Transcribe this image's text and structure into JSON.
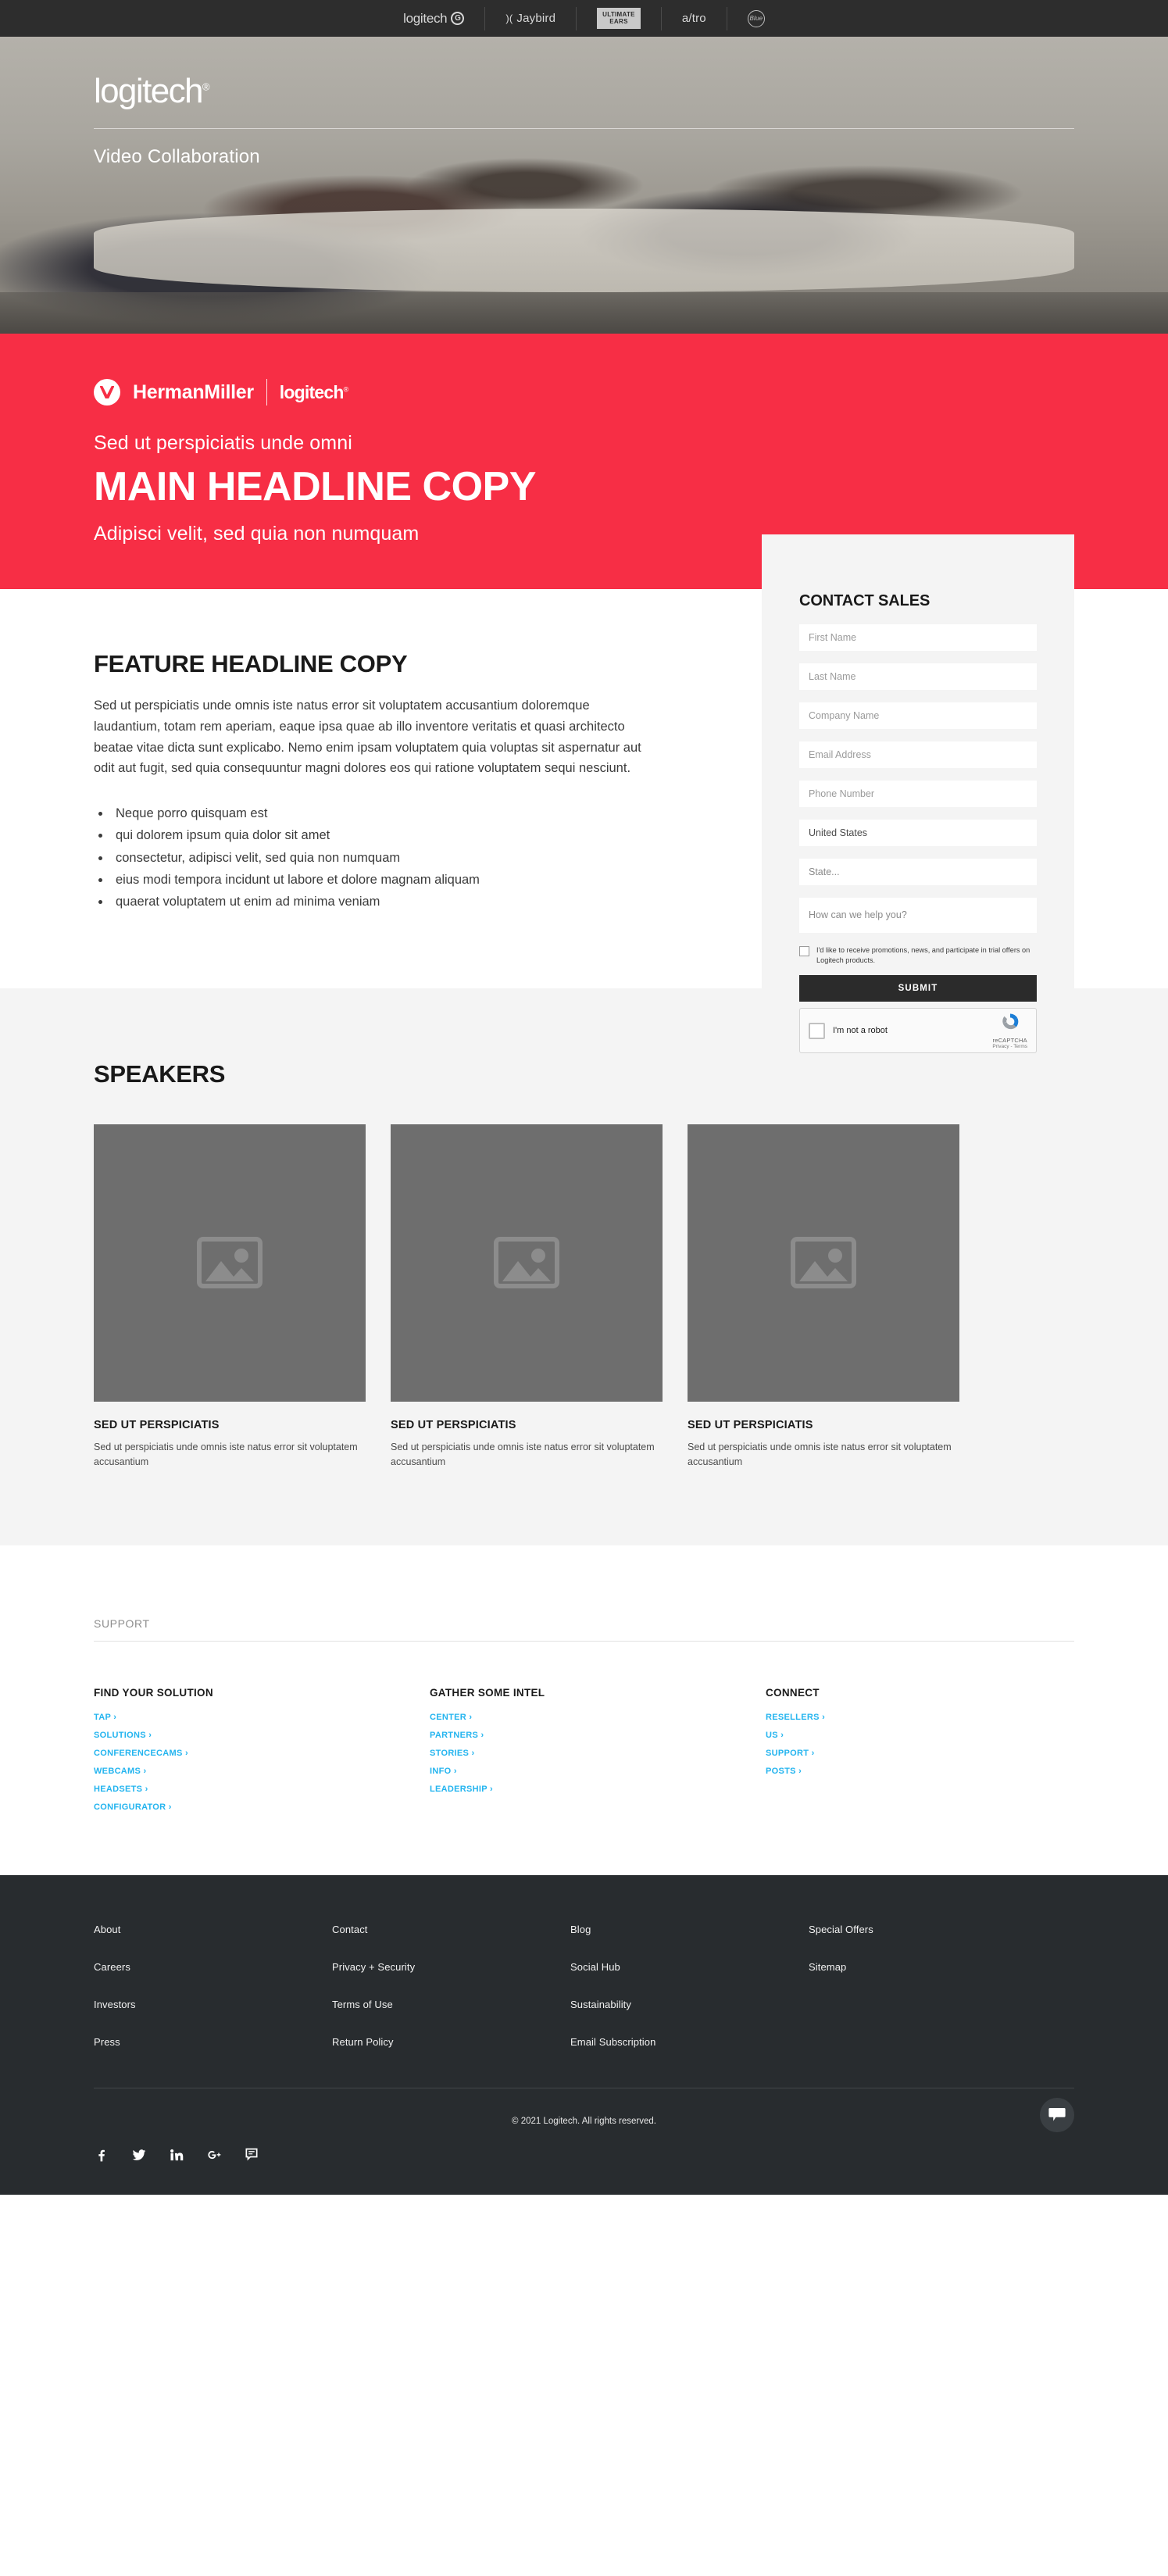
{
  "brandbar": {
    "items": [
      {
        "name": "logitech",
        "label": "logitech",
        "badge": "G"
      },
      {
        "name": "jaybird",
        "label": "Jaybird"
      },
      {
        "name": "ultimate-ears",
        "line1": "ULTIMATE",
        "line2": "EARS"
      },
      {
        "name": "astro",
        "label": "a/tro"
      },
      {
        "name": "blue",
        "label": "Blue"
      }
    ]
  },
  "hero": {
    "logo": "logitech",
    "logo_tm": "®",
    "subtitle": "Video Collaboration"
  },
  "redband": {
    "bg_color": "#f72e45",
    "hermanmiller_label": "HermanMiller",
    "logitech_label": "logitech",
    "logitech_tm": "®",
    "eyebrow": "Sed ut perspiciatis unde omni",
    "headline": "MAIN HEADLINE COPY",
    "subhead": "Adipisci velit, sed quia non numquam"
  },
  "feature": {
    "heading": "FEATURE HEADLINE COPY",
    "paragraph": "Sed ut perspiciatis unde omnis iste natus error sit voluptatem accusantium doloremque laudantium, totam rem aperiam, eaque ipsa quae ab illo inventore veritatis et quasi architecto beatae vitae dicta sunt explicabo. Nemo enim ipsam voluptatem quia voluptas sit aspernatur aut odit aut fugit, sed quia consequuntur magni dolores eos qui ratione voluptatem sequi nesciunt.",
    "bullets": [
      "Neque porro quisquam est",
      "qui dolorem ipsum quia dolor sit amet",
      "consectetur, adipisci velit, sed quia non numquam",
      "eius modi tempora incidunt ut labore et dolore magnam aliquam",
      "quaerat voluptatem ut enim ad minima veniam"
    ]
  },
  "form": {
    "title": "CONTACT SALES",
    "first_name_placeholder": "First Name",
    "last_name_placeholder": "Last Name",
    "company_placeholder": "Company Name",
    "email_placeholder": "Email Address",
    "phone_placeholder": "Phone Number",
    "country_value": "United States",
    "state_placeholder": "State...",
    "message_placeholder": "How can we help you?",
    "optin_label": "I'd like to receive promotions, news, and participate in trial offers on Logitech products.",
    "submit_label": "SUBMIT",
    "recaptcha_label": "I'm not a robot",
    "recaptcha_brand": "reCAPTCHA",
    "recaptcha_terms": "Privacy - Terms"
  },
  "speakers": {
    "heading": "SPEAKERS",
    "cards": [
      {
        "title": "SED UT PERSPICIATIS",
        "body": "Sed ut perspiciatis unde omnis iste natus error sit voluptatem accusantium"
      },
      {
        "title": "SED UT PERSPICIATIS",
        "body": "Sed ut perspiciatis unde omnis iste natus error sit voluptatem accusantium"
      },
      {
        "title": "SED UT PERSPICIATIS",
        "body": "Sed ut perspiciatis unde omnis iste natus error sit voluptatem accusantium"
      }
    ]
  },
  "support": {
    "title": "SUPPORT",
    "link_color": "#23b4ef",
    "columns": [
      {
        "heading": "FIND YOUR SOLUTION",
        "links": [
          "TAP",
          "SOLUTIONS",
          "CONFERENCECAMS",
          "WEBCAMS",
          "HEADSETS",
          "CONFIGURATOR"
        ]
      },
      {
        "heading": "GATHER SOME INTEL",
        "links": [
          "CENTER",
          "PARTNERS",
          "STORIES",
          "INFO",
          "LEADERSHIP"
        ]
      },
      {
        "heading": "CONNECT",
        "links": [
          "RESELLERS",
          "US",
          "SUPPORT",
          "POSTS"
        ]
      }
    ]
  },
  "footer": {
    "bg_color": "#282c2f",
    "columns": [
      [
        "About",
        "Careers",
        "Investors",
        "Press"
      ],
      [
        "Contact",
        "Privacy + Security",
        "Terms of Use",
        "Return Policy"
      ],
      [
        "Blog",
        "Social Hub",
        "Sustainability",
        "Email Subscription"
      ],
      [
        "Special Offers",
        "Sitemap"
      ]
    ],
    "socials": [
      "facebook-icon",
      "twitter-icon",
      "linkedin-icon",
      "google-plus-icon",
      "forum-icon"
    ],
    "copyright": "© 2021 Logitech. All rights reserved."
  }
}
